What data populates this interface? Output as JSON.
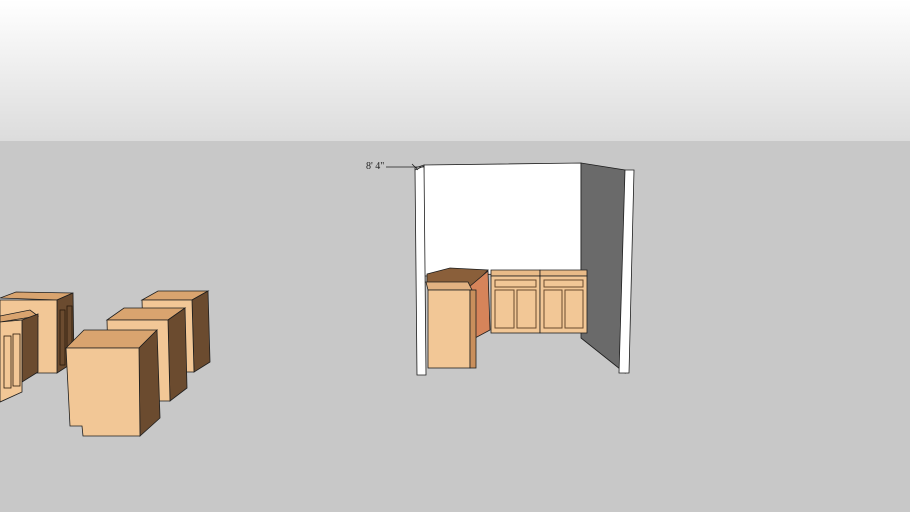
{
  "viewport": {
    "sky_top_color": "#ffffff",
    "sky_bottom_color": "#dcdcdc",
    "ground_color": "#c8c8c8",
    "wall_face_color": "#ffffff",
    "wall_shade_color": "#6a6a6a",
    "wood_light_color": "#f2c796",
    "wood_mid_color": "#d9a46f",
    "wood_dark_color": "#6b4b2f",
    "edge_color": "#1e1e1e"
  },
  "dimension": {
    "label": "8' 4\""
  }
}
